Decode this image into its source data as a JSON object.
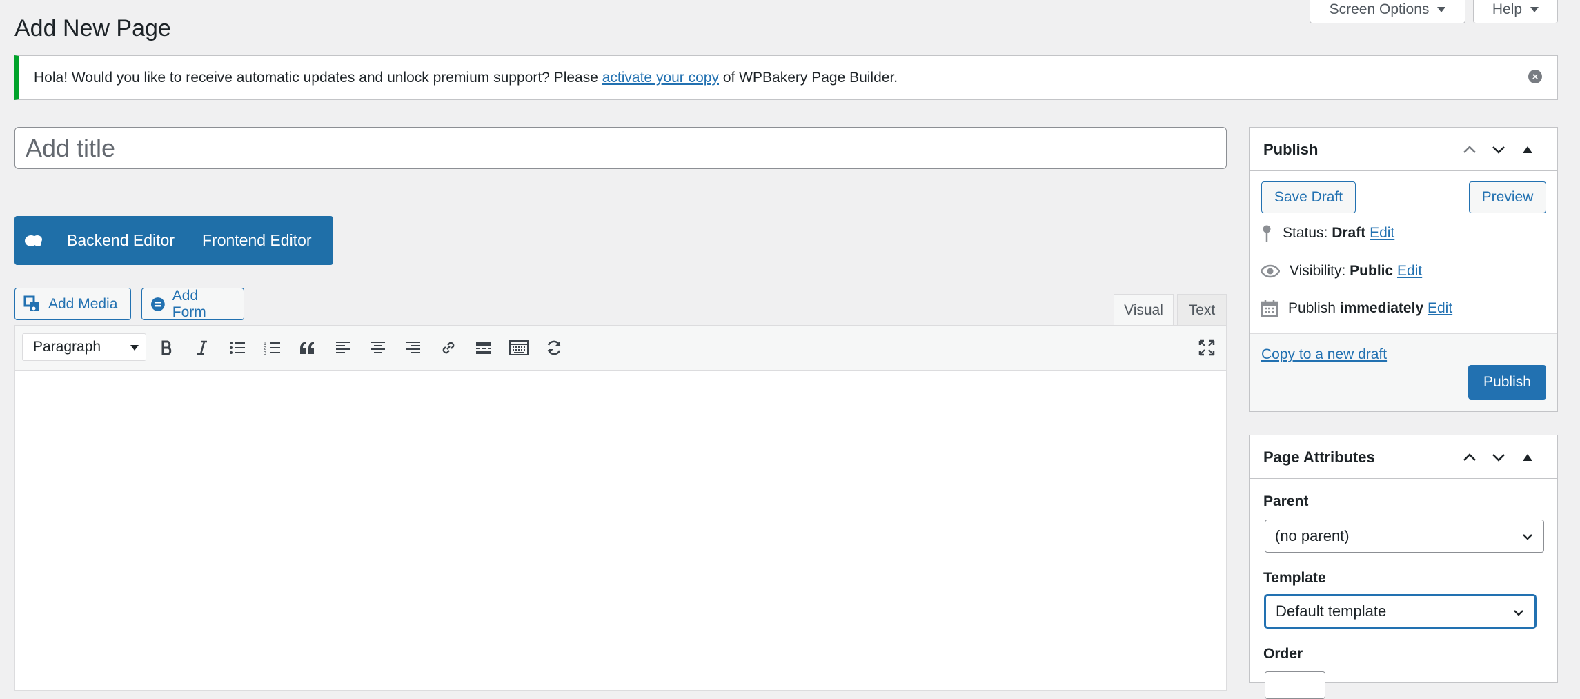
{
  "screen_meta": {
    "screen_options": "Screen Options",
    "help": "Help"
  },
  "page": {
    "title": "Add New Page"
  },
  "notice": {
    "text_before": "Hola! Would you like to receive automatic updates and unlock premium support? Please ",
    "link": "activate your copy",
    "text_after": " of WPBakery Page Builder."
  },
  "title_input": {
    "placeholder": "Add title",
    "value": ""
  },
  "vc": {
    "backend": "Backend Editor",
    "frontend": "Frontend Editor"
  },
  "media": {
    "add_media": "Add Media",
    "add_form": "Add Form"
  },
  "editor": {
    "tabs": {
      "visual": "Visual",
      "text": "Text"
    },
    "format_select": "Paragraph",
    "toolbar_icons": [
      "bold-icon",
      "italic-icon",
      "bulleted-list-icon",
      "numbered-list-icon",
      "blockquote-icon",
      "align-left-icon",
      "align-center-icon",
      "align-right-icon",
      "link-icon",
      "read-more-icon",
      "toolbar-toggle-icon",
      "refresh-icon",
      "fullscreen-icon"
    ]
  },
  "publish_box": {
    "title": "Publish",
    "save_draft": "Save Draft",
    "preview": "Preview",
    "status_label": "Status:",
    "status_value": "Draft",
    "visibility_label": "Visibility:",
    "visibility_value": "Public",
    "publish_label": "Publish",
    "publish_value": "immediately",
    "edit": "Edit",
    "copy_draft": "Copy to a new draft",
    "publish_button": "Publish"
  },
  "attributes_box": {
    "title": "Page Attributes",
    "parent_label": "Parent",
    "parent_value": "(no parent)",
    "template_label": "Template",
    "template_value": "Default template",
    "order_label": "Order"
  },
  "colors": {
    "accent": "#2271b1",
    "vc_bar": "#1f6fa8",
    "notice_success": "#00a32a"
  }
}
